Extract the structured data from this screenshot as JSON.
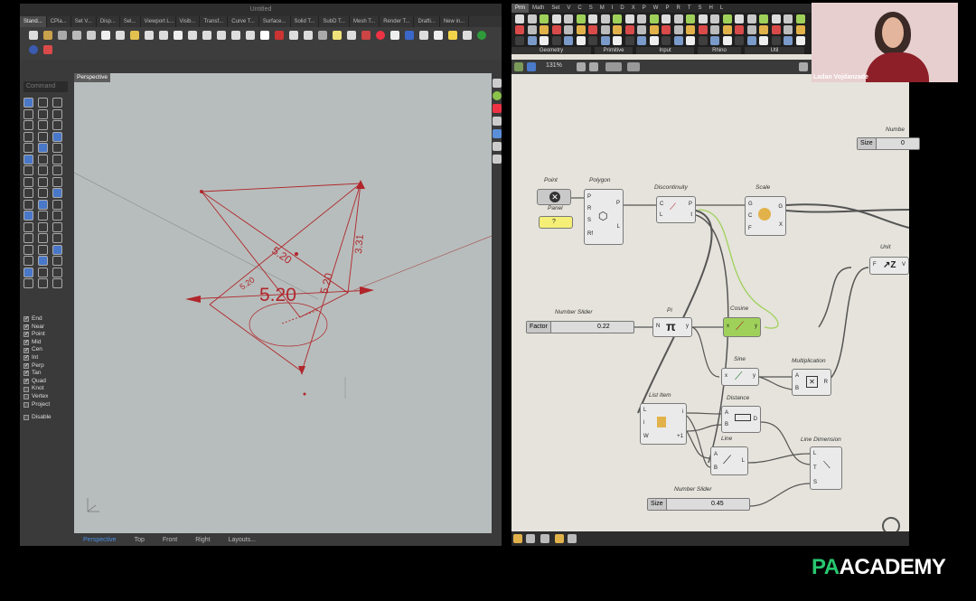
{
  "rhino": {
    "title": "Untitled",
    "tabs": [
      "Stand...",
      "CPla...",
      "Set V...",
      "Disp...",
      "Sel...",
      "Viewport L...",
      "Visib...",
      "Transf...",
      "Curve T...",
      "Surface...",
      "Solid T...",
      "SubD T...",
      "Mesh T...",
      "Render T...",
      "Drafti...",
      "New in..."
    ],
    "command_placeholder": "Command",
    "viewport_label": "Perspective",
    "osnaps": [
      {
        "label": "End",
        "checked": true
      },
      {
        "label": "Near",
        "checked": true
      },
      {
        "label": "Point",
        "checked": true
      },
      {
        "label": "Mid",
        "checked": true
      },
      {
        "label": "Cen",
        "checked": true
      },
      {
        "label": "Int",
        "checked": true
      },
      {
        "label": "Perp",
        "checked": true
      },
      {
        "label": "Tan",
        "checked": true
      },
      {
        "label": "Quad",
        "checked": true
      },
      {
        "label": "Knot",
        "checked": false
      },
      {
        "label": "Vertex",
        "checked": false
      },
      {
        "label": "Project",
        "checked": false
      }
    ],
    "disable_label": "Disable",
    "view_tabs": [
      "Perspective",
      "Top",
      "Front",
      "Right",
      "Layouts..."
    ],
    "dims": {
      "main": "5.20",
      "a": "5.20",
      "b": "5.20",
      "c": "5.20",
      "d": "3.31"
    },
    "geometry_color": "#b0262b",
    "viewport_bg": "#b7bdbc"
  },
  "grasshopper": {
    "menu": [
      "Prm",
      "Math",
      "Set",
      "V",
      "C",
      "S",
      "M",
      "I",
      "D",
      "X",
      "P",
      "W",
      "P",
      "R",
      "T",
      "S",
      "H",
      "L"
    ],
    "groups": [
      "Geometry",
      "Primitive",
      "Input",
      "Rhino",
      "Util"
    ],
    "zoom": "131%",
    "components": {
      "point": "Point",
      "polygon": "Polygon",
      "panel": "Panel",
      "discontinuity": "Discontinuity",
      "scale": "Scale",
      "number_top": "Numbe",
      "unit": "Unit",
      "pi": "Pi",
      "cosine": "Cosine",
      "sine": "Sine",
      "multiplication": "Multiplication",
      "list_item": "List Item",
      "distance": "Distance",
      "line": "Line",
      "line_dimension": "Line Dimension",
      "number_slider_1": "Number Slider",
      "number_slider_2": "Number Slider"
    },
    "sliders": {
      "size_top": {
        "label": "Size",
        "value": "0"
      },
      "factor": {
        "label": "Factor",
        "value": "0.22"
      },
      "size": {
        "label": "Size",
        "value": "0.45"
      }
    },
    "panel_value": "?"
  },
  "video": {
    "name": "Ladan Vojdanzade"
  },
  "logo": {
    "pa": "PA",
    "rest": "ACADEMY"
  }
}
